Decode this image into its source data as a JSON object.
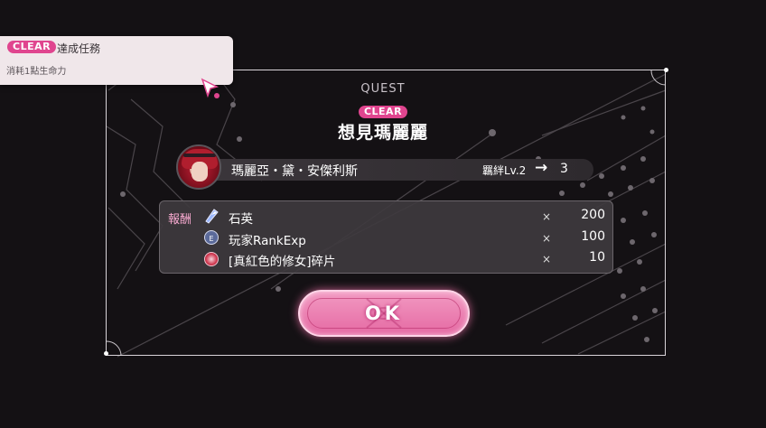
{
  "toast": {
    "badge": "CLEAR",
    "title": "達成任務",
    "subtitle": "消耗1點生命力"
  },
  "dialog": {
    "header": "QUEST",
    "status_badge": "CLEAR",
    "quest_name": "想見瑪麗麗"
  },
  "character": {
    "name": "瑪麗亞・黛・安傑利斯",
    "bond_label": "羈絆Lv.2",
    "bond_arrow": "→",
    "bond_next": "3"
  },
  "rewards": {
    "heading": "報酬",
    "items": [
      {
        "icon": "quartz-crystal-icon",
        "name": "石英",
        "mult": "×",
        "value": "200"
      },
      {
        "icon": "player-exp-coin-icon",
        "name": "玩家RankExp",
        "mult": "×",
        "value": "100"
      },
      {
        "icon": "character-shard-icon",
        "name": "[真紅色的修女]碎片",
        "mult": "×",
        "value": "10"
      }
    ]
  },
  "ok_button": {
    "label": "OK"
  },
  "colors": {
    "accent_pink": "#e0458f",
    "background": "#141114",
    "panel_border": "#d9d4d9"
  }
}
